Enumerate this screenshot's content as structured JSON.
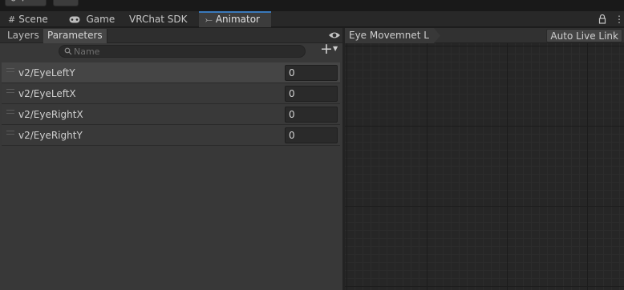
{
  "tabs": [
    {
      "label": "Scene",
      "icon": "grid-icon",
      "active": false
    },
    {
      "label": "Game",
      "icon": "gamepad-icon",
      "active": false
    },
    {
      "label": "VRChat SDK",
      "icon": "",
      "active": false
    },
    {
      "label": "Animator",
      "icon": "animator-icon",
      "active": true
    }
  ],
  "left_panel": {
    "tabs": [
      "Layers",
      "Parameters"
    ],
    "active_tab": "Parameters",
    "search_placeholder": "Name",
    "parameters": [
      {
        "name": "v2/EyeLeftY",
        "value": "0"
      },
      {
        "name": "v2/EyeLeftX",
        "value": "0"
      },
      {
        "name": "v2/EyeRightX",
        "value": "0"
      },
      {
        "name": "v2/EyeRightY",
        "value": "0"
      }
    ]
  },
  "graph": {
    "breadcrumb": "Eye Movemnet L",
    "auto_live_link_label": "Auto Live Link"
  },
  "colors": {
    "accent": "#3a79bb",
    "panel_bg": "#383838",
    "graph_bg": "#262626"
  }
}
